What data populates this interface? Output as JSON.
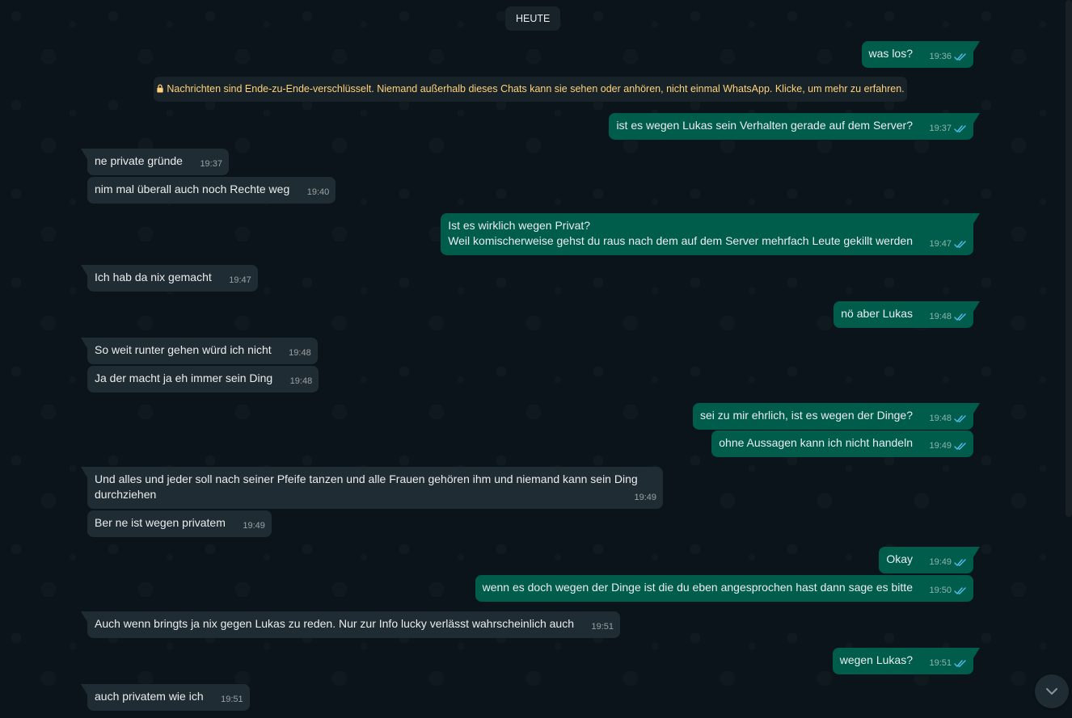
{
  "day_chip": "HEUTE",
  "encryption_notice": "Nachrichten sind Ende-zu-Ende-verschlüsselt. Niemand außerhalb dieses Chats kann sie sehen oder anhören, nicht einmal WhatsApp. Klicke, um mehr zu erfahren.",
  "colors": {
    "background": "#0b141a",
    "incoming": "#202c33",
    "outgoing": "#005c4b",
    "notice_text": "#ffd279",
    "read_ticks": "#53bdeb"
  },
  "messages": [
    {
      "dir": "out",
      "text": "was los?",
      "time": "19:36",
      "status": "read"
    },
    {
      "dir": "out",
      "text": "ist es wegen Lukas sein Verhalten gerade auf dem Server?",
      "time": "19:37",
      "status": "read"
    },
    {
      "dir": "in",
      "text": "ne private gründe",
      "time": "19:37"
    },
    {
      "dir": "in",
      "text": "nim mal überall auch noch Rechte weg",
      "time": "19:40"
    },
    {
      "dir": "out",
      "text": "Ist es wirklich wegen Privat?\nWeil komischerweise gehst du raus nach dem auf dem Server mehrfach Leute gekillt werden",
      "time": "19:47",
      "status": "read"
    },
    {
      "dir": "in",
      "text": "Ich hab da nix gemacht",
      "time": "19:47"
    },
    {
      "dir": "out",
      "text": "nö aber Lukas",
      "time": "19:48",
      "status": "read"
    },
    {
      "dir": "in",
      "text": "So weit runter gehen würd ich nicht",
      "time": "19:48"
    },
    {
      "dir": "in",
      "text": "Ja der macht ja eh immer sein Ding",
      "time": "19:48"
    },
    {
      "dir": "out",
      "text": "sei zu mir ehrlich, ist es wegen der Dinge?",
      "time": "19:48",
      "status": "read"
    },
    {
      "dir": "out",
      "text": "ohne Aussagen kann ich nicht handeln",
      "time": "19:49",
      "status": "read"
    },
    {
      "dir": "in",
      "text": "Und alles und jeder soll nach seiner Pfeife tanzen und alle Frauen gehören ihm und niemand kann sein Ding durchziehen",
      "time": "19:49"
    },
    {
      "dir": "in",
      "text": "Ber ne ist wegen privatem",
      "time": "19:49"
    },
    {
      "dir": "out",
      "text": "Okay",
      "time": "19:49",
      "status": "read"
    },
    {
      "dir": "out",
      "text": "wenn es doch wegen der Dinge ist die du eben angesprochen hast dann sage es bitte",
      "time": "19:50",
      "status": "read"
    },
    {
      "dir": "in",
      "text": "Auch wenn bringts ja nix gegen Lukas zu reden. Nur zur Info lucky verlässt wahrscheinlich auch",
      "time": "19:51"
    },
    {
      "dir": "out",
      "text": "wegen Lukas?",
      "time": "19:51",
      "status": "read"
    },
    {
      "dir": "in",
      "text": "auch privatem wie ich",
      "time": "19:51"
    }
  ]
}
